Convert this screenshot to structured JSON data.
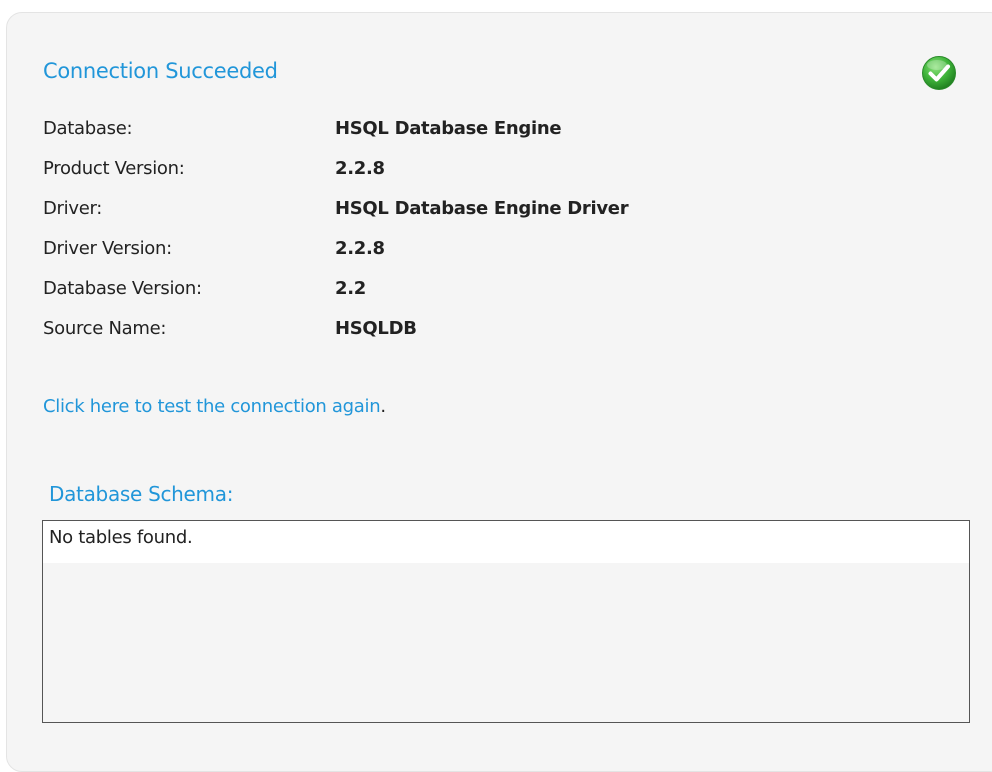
{
  "header": {
    "title": "Connection Succeeded",
    "status_icon": "check-circle-icon",
    "status_color": "#3cb43c"
  },
  "details": [
    {
      "label": "Database:",
      "value": "HSQL Database Engine"
    },
    {
      "label": "Product Version:",
      "value": "2.2.8"
    },
    {
      "label": "Driver:",
      "value": "HSQL Database Engine Driver"
    },
    {
      "label": "Driver Version:",
      "value": "2.2.8"
    },
    {
      "label": "Database Version:",
      "value": "2.2"
    },
    {
      "label": "Source Name:",
      "value": "HSQLDB"
    }
  ],
  "retest": {
    "link_text": "Click here to test the connection again",
    "suffix": "."
  },
  "schema": {
    "title": "Database Schema:",
    "empty_message": "No tables found."
  },
  "colors": {
    "accent": "#2196d9",
    "panel_bg": "#f5f5f5",
    "text": "#222222"
  }
}
